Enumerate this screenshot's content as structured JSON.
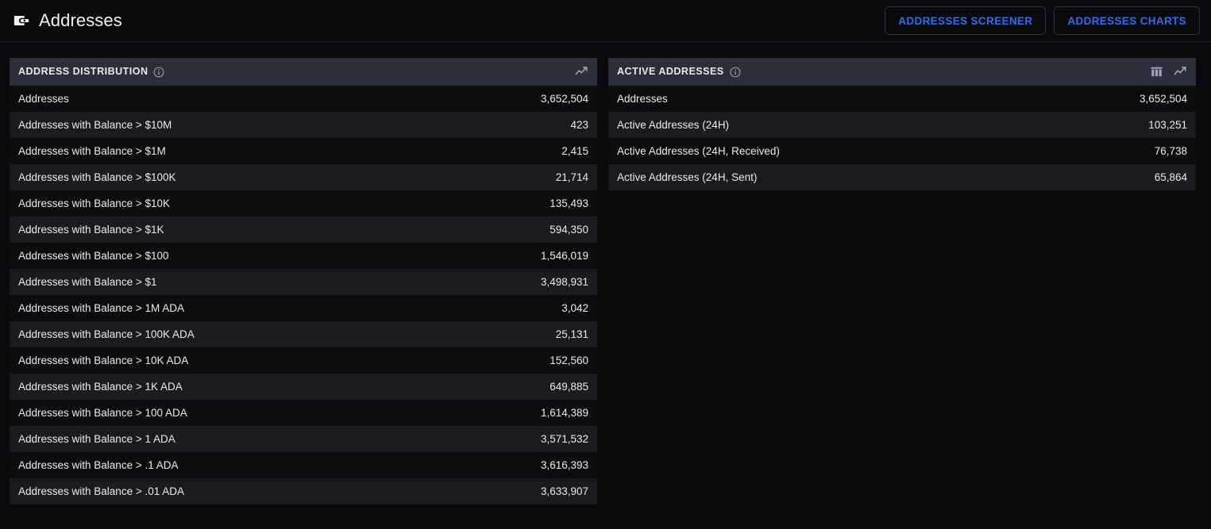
{
  "header": {
    "icon": "wallet-icon",
    "title": "Addresses",
    "buttons": [
      {
        "label": "ADDRESSES SCREENER",
        "name": "addresses-screener-button"
      },
      {
        "label": "ADDRESSES CHARTS",
        "name": "addresses-charts-button"
      }
    ],
    "accent_color": "#2f6dea"
  },
  "panels": [
    {
      "name": "address-distribution-panel",
      "title": "ADDRESS DISTRIBUTION",
      "info_icon": "info-icon",
      "header_icons": [
        "line-chart-icon"
      ],
      "rows": [
        {
          "label": "Addresses",
          "value": "3,652,504"
        },
        {
          "label": "Addresses with Balance > $10M",
          "value": "423"
        },
        {
          "label": "Addresses with Balance > $1M",
          "value": "2,415"
        },
        {
          "label": "Addresses with Balance > $100K",
          "value": "21,714"
        },
        {
          "label": "Addresses with Balance > $10K",
          "value": "135,493"
        },
        {
          "label": "Addresses with Balance > $1K",
          "value": "594,350"
        },
        {
          "label": "Addresses with Balance > $100",
          "value": "1,546,019"
        },
        {
          "label": "Addresses with Balance > $1",
          "value": "3,498,931"
        },
        {
          "label": "Addresses with Balance > 1M ADA",
          "value": "3,042"
        },
        {
          "label": "Addresses with Balance > 100K ADA",
          "value": "25,131"
        },
        {
          "label": "Addresses with Balance > 10K ADA",
          "value": "152,560"
        },
        {
          "label": "Addresses with Balance > 1K ADA",
          "value": "649,885"
        },
        {
          "label": "Addresses with Balance > 100 ADA",
          "value": "1,614,389"
        },
        {
          "label": "Addresses with Balance > 1 ADA",
          "value": "3,571,532"
        },
        {
          "label": "Addresses with Balance > .1 ADA",
          "value": "3,616,393"
        },
        {
          "label": "Addresses with Balance > .01 ADA",
          "value": "3,633,907"
        }
      ]
    },
    {
      "name": "active-addresses-panel",
      "title": "ACTIVE ADDRESSES",
      "info_icon": "info-icon",
      "header_icons": [
        "table-columns-icon",
        "line-chart-icon"
      ],
      "rows": [
        {
          "label": "Addresses",
          "value": "3,652,504"
        },
        {
          "label": "Active Addresses (24H)",
          "value": "103,251"
        },
        {
          "label": "Active Addresses (24H, Received)",
          "value": "76,738"
        },
        {
          "label": "Active Addresses (24H, Sent)",
          "value": "65,864"
        }
      ]
    }
  ]
}
